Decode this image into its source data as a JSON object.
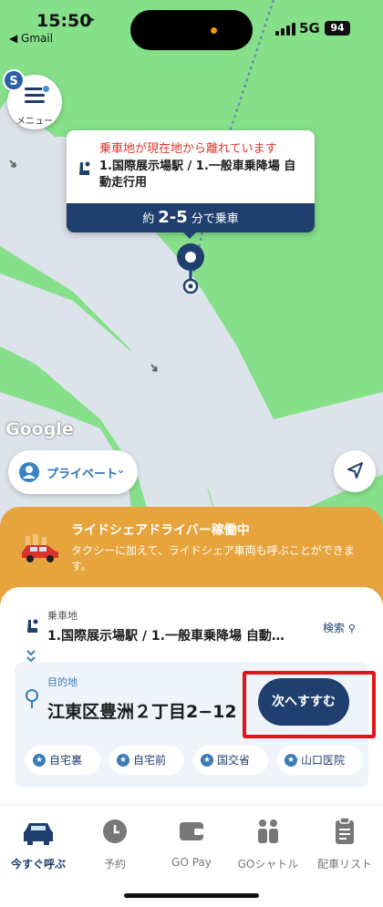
{
  "status_bar": {
    "time": "15:50",
    "back_app": "◀ Gmail",
    "network": "5G",
    "battery": "94"
  },
  "menu": {
    "label": "メニュー",
    "badge": "S"
  },
  "pickup_card": {
    "warning": "乗車地が現在地から離れています",
    "name": "1.国際展示場駅 / 1.一般車乗降場 自動走行用",
    "eta_prefix": "約",
    "eta_value": "2-5",
    "eta_suffix": "分で乗車"
  },
  "map": {
    "attribution": "Google"
  },
  "profile": {
    "label": "プライベート"
  },
  "banner": {
    "title": "ライドシェアドライバー稼働中",
    "description": "タクシーに加えて、ライドシェア車両も呼ぶことができます。"
  },
  "pickup": {
    "label": "乗車地",
    "name": "1.国際展示場駅 / 1.一般車乗降場 自動…",
    "search_label": "検索"
  },
  "destination": {
    "label": "目的地",
    "name": "江東区豊洲２丁目2−12",
    "next_button": "次へすすむ"
  },
  "favorites": [
    "自宅裏",
    "自宅前",
    "国交省",
    "山口医院"
  ],
  "tabs": [
    {
      "label": "今すぐ呼ぶ",
      "icon": "car-icon",
      "active": true
    },
    {
      "label": "予約",
      "icon": "clock-icon"
    },
    {
      "label": "GO Pay",
      "icon": "wallet-icon"
    },
    {
      "label": "GOシャトル",
      "icon": "people-icon"
    },
    {
      "label": "配車リスト",
      "icon": "clipboard-icon"
    }
  ],
  "colors": {
    "primary": "#1f3f6e",
    "banner": "#e7a43c",
    "warning": "#d9342b",
    "highlight": "#e0151b",
    "map_green": "#86e08a"
  }
}
